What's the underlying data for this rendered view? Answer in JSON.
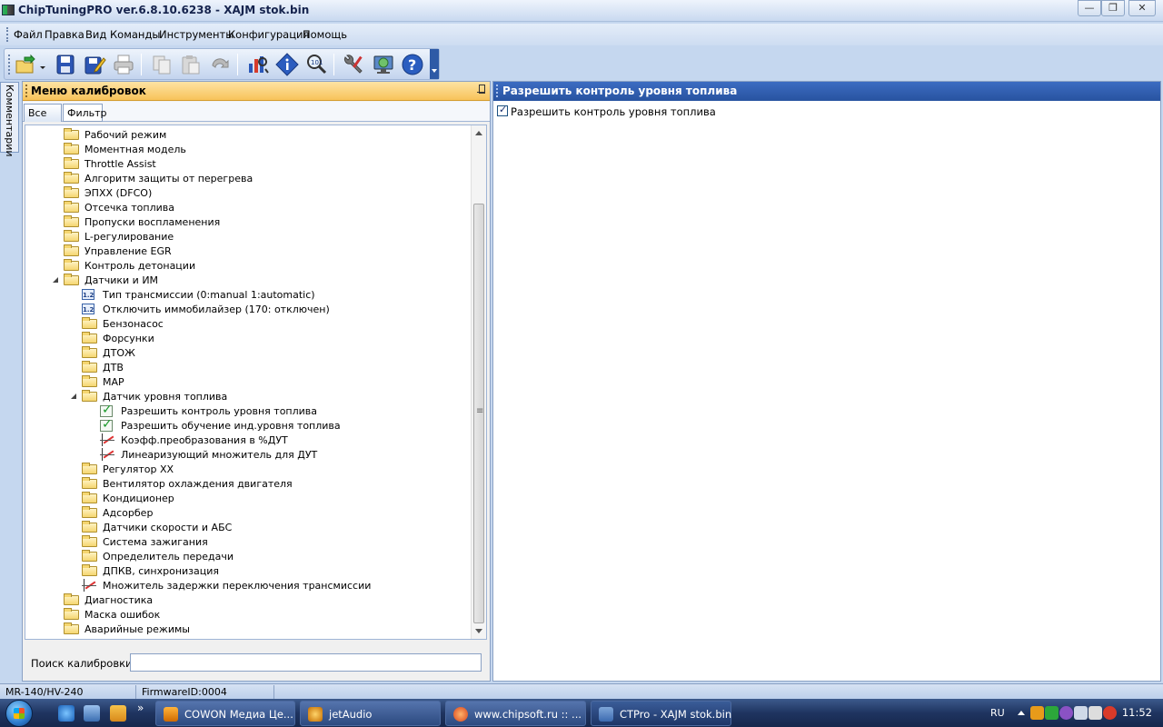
{
  "window": {
    "title": "ChipTuningPRO ver.6.8.10.6238 - XAJM stok.bin"
  },
  "menu": [
    "Файл",
    "Правка",
    "Вид",
    "Команды",
    "Инструменты",
    "Конфигурация",
    "Помощь"
  ],
  "side_tab": "Комментарии",
  "left_panel": {
    "title": "Меню калибровок",
    "tabs": [
      "Все",
      "Фильтр"
    ],
    "search_label": "Поиск калибровки",
    "search_value": ""
  },
  "tree": [
    {
      "label": "Рабочий режим",
      "type": "folder",
      "level": 0,
      "state": "collapsed"
    },
    {
      "label": "Моментная модель",
      "type": "folder",
      "level": 0,
      "state": "collapsed"
    },
    {
      "label": "Throttle Assist",
      "type": "folder",
      "level": 0,
      "state": "collapsed"
    },
    {
      "label": "Алгоритм защиты от перегрева",
      "type": "folder",
      "level": 0,
      "state": "collapsed"
    },
    {
      "label": "ЭПХХ (DFCO)",
      "type": "folder",
      "level": 0,
      "state": "collapsed"
    },
    {
      "label": "Отсечка топлива",
      "type": "folder",
      "level": 0,
      "state": "collapsed"
    },
    {
      "label": "Пропуски воспламенения",
      "type": "folder",
      "level": 0,
      "state": "collapsed"
    },
    {
      "label": "L-регулирование",
      "type": "folder",
      "level": 0,
      "state": "collapsed"
    },
    {
      "label": "Управление EGR",
      "type": "folder",
      "level": 0,
      "state": "collapsed"
    },
    {
      "label": "Контроль детонации",
      "type": "folder",
      "level": 0,
      "state": "collapsed"
    },
    {
      "label": "Датчики и ИМ",
      "type": "folder",
      "level": 0,
      "state": "expanded"
    },
    {
      "label": "Тип трансмиссии (0:manual 1:automatic)",
      "type": "number",
      "level": 1,
      "state": "leaf"
    },
    {
      "label": "Отключить иммобилайзер (170: отключен)",
      "type": "number",
      "level": 1,
      "state": "leaf"
    },
    {
      "label": "Бензонасос",
      "type": "folder",
      "level": 1,
      "state": "collapsed"
    },
    {
      "label": "Форсунки",
      "type": "folder",
      "level": 1,
      "state": "collapsed"
    },
    {
      "label": "ДТОЖ",
      "type": "folder",
      "level": 1,
      "state": "collapsed"
    },
    {
      "label": "ДТВ",
      "type": "folder",
      "level": 1,
      "state": "collapsed"
    },
    {
      "label": "MAP",
      "type": "folder",
      "level": 1,
      "state": "collapsed"
    },
    {
      "label": "Датчик уровня топлива",
      "type": "folder",
      "level": 1,
      "state": "expanded"
    },
    {
      "label": "Разрешить контроль уровня топлива",
      "type": "check",
      "level": 2,
      "state": "leaf"
    },
    {
      "label": "Разрешить обучение инд.уровня топлива",
      "type": "check",
      "level": 2,
      "state": "leaf"
    },
    {
      "label": "Коэфф.преобразования в %ДУТ",
      "type": "graph",
      "level": 2,
      "state": "leaf"
    },
    {
      "label": "Линеаризующий множитель для ДУТ",
      "type": "graph",
      "level": 2,
      "state": "leaf"
    },
    {
      "label": "Регулятор ХХ",
      "type": "folder",
      "level": 1,
      "state": "collapsed"
    },
    {
      "label": "Вентилятор охлаждения двигателя",
      "type": "folder",
      "level": 1,
      "state": "collapsed"
    },
    {
      "label": "Кондиционер",
      "type": "folder",
      "level": 1,
      "state": "collapsed"
    },
    {
      "label": "Адсорбер",
      "type": "folder",
      "level": 1,
      "state": "collapsed"
    },
    {
      "label": "Датчики скорости и АБС",
      "type": "folder",
      "level": 1,
      "state": "collapsed"
    },
    {
      "label": "Система зажигания",
      "type": "folder",
      "level": 1,
      "state": "collapsed"
    },
    {
      "label": "Определитель передачи",
      "type": "folder",
      "level": 1,
      "state": "collapsed"
    },
    {
      "label": "ДПКВ, синхронизация",
      "type": "folder",
      "level": 1,
      "state": "collapsed"
    },
    {
      "label": "Множитель задержки переключения трансмиссии",
      "type": "graph",
      "level": 1,
      "state": "leaf"
    },
    {
      "label": "Диагностика",
      "type": "folder",
      "level": 0,
      "state": "collapsed"
    },
    {
      "label": "Маска ошибок",
      "type": "folder",
      "level": 0,
      "state": "collapsed"
    },
    {
      "label": "Аварийные режимы",
      "type": "folder",
      "level": 0,
      "state": "collapsed"
    }
  ],
  "right_panel": {
    "title": "Разрешить контроль уровня топлива",
    "option_label": "Разрешить контроль уровня топлива",
    "option_checked": true
  },
  "status": {
    "model": "MR-140/HV-240",
    "firmware": "FirmwareID:0004"
  },
  "taskbar": {
    "tasks": [
      "COWON Медиа Це...",
      "jetAudio",
      "www.chipsoft.ru :: ...",
      "CTPro - XAJM stok.bin"
    ],
    "lang": "RU",
    "clock": "11:52"
  },
  "colors": {
    "panel_header_orange": "#f8c35a",
    "right_header_blue": "#2853a0",
    "taskbar": "#1f3460"
  }
}
